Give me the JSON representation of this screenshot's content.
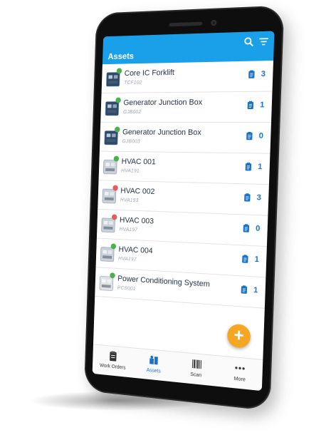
{
  "appbar": {
    "title": "Assets",
    "icons": [
      "search-icon",
      "filter-icon"
    ]
  },
  "colors": {
    "primary": "#1aa0e8",
    "fab": "#f5a623",
    "status_ok": "#4caf50",
    "status_alert": "#e75b5b",
    "count": "#1a73c6"
  },
  "assets": [
    {
      "name": "Core IC Forklift",
      "code": "TCF102",
      "work_orders": "3",
      "status": "ok",
      "thumb": "forklift-icon"
    },
    {
      "name": "Generator Junction Box",
      "code": "GJB002",
      "work_orders": "1",
      "status": "ok",
      "thumb": "junction-box-icon"
    },
    {
      "name": "Generator Junction Box",
      "code": "GJB003",
      "work_orders": "0",
      "status": "ok",
      "thumb": "junction-box-icon"
    },
    {
      "name": "HVAC 001",
      "code": "HVA191",
      "work_orders": "1",
      "status": "ok",
      "thumb": "hvac-unit-icon"
    },
    {
      "name": "HVAC 002",
      "code": "HVA193",
      "work_orders": "3",
      "status": "alert",
      "thumb": "hvac-unit-icon"
    },
    {
      "name": "HVAC 003",
      "code": "HVA197",
      "work_orders": "0",
      "status": "alert",
      "thumb": "hvac-unit-icon"
    },
    {
      "name": "HVAC 004",
      "code": "HVA197",
      "work_orders": "1",
      "status": "ok",
      "thumb": "hvac-unit-icon"
    },
    {
      "name": "Power Conditioning System",
      "code": "PCS001",
      "work_orders": "1",
      "status": "ok",
      "thumb": "power-cabinet-icon"
    }
  ],
  "fab": {
    "label": "+"
  },
  "bottom_nav": [
    {
      "label": "Work Orders",
      "icon": "clipboard-icon",
      "active": false
    },
    {
      "label": "Assets",
      "icon": "assets-icon",
      "active": true
    },
    {
      "label": "Scan",
      "icon": "barcode-icon",
      "active": false
    },
    {
      "label": "More",
      "icon": "more-dots-icon",
      "active": false
    }
  ]
}
